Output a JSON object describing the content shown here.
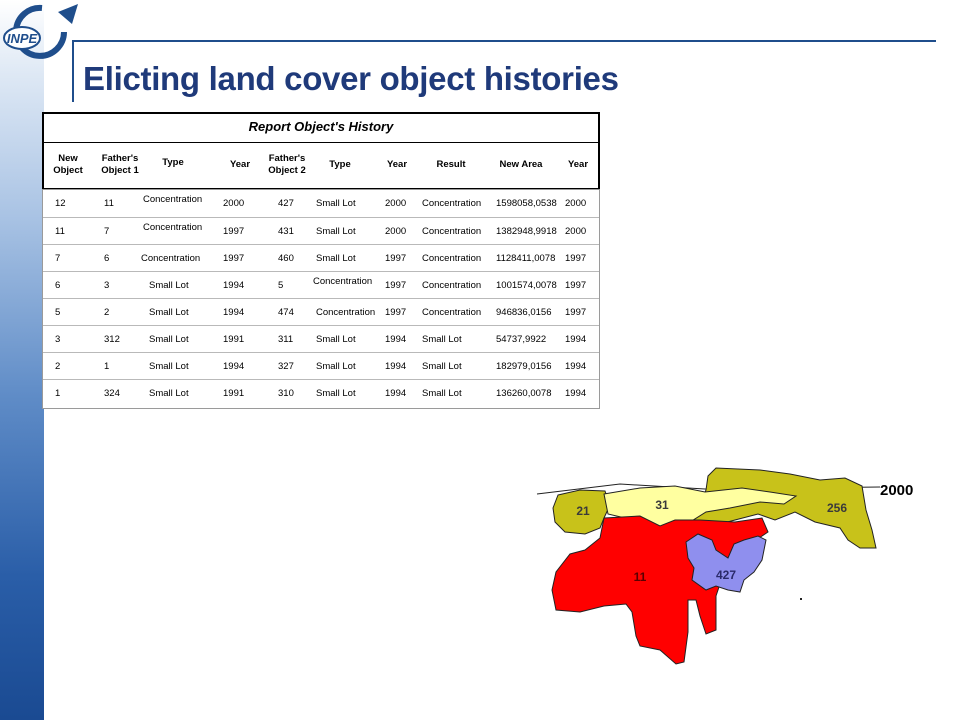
{
  "slide": {
    "title": "Elicting land cover object histories",
    "logo_text": "INPE"
  },
  "report": {
    "title": "Report Object's History",
    "columns": [
      "New Object",
      "Father's Object 1",
      "Type",
      "Year",
      "Father's Object 2",
      "Type",
      "Year",
      "Result",
      "New Area",
      "Year"
    ],
    "rows": [
      [
        "12",
        "11",
        "Concentration",
        "2000",
        "427",
        "Small Lot",
        "2000",
        "Concentration",
        "1598058,0538",
        "2000"
      ],
      [
        "11",
        "7",
        "Concentration",
        "1997",
        "431",
        "Small Lot",
        "2000",
        "Concentration",
        "1382948,9918",
        "2000"
      ],
      [
        "7",
        "6",
        "Concentration",
        "1997",
        "460",
        "Small Lot",
        "1997",
        "Concentration",
        "1128411,0078",
        "1997"
      ],
      [
        "6",
        "3",
        "Small Lot",
        "1994",
        "5",
        "Concentration",
        "1997",
        "Concentration",
        "1001574,0078",
        "1997"
      ],
      [
        "5",
        "2",
        "Small Lot",
        "1994",
        "474",
        "Concentration",
        "1997",
        "Concentration",
        "946836,0156",
        "1997"
      ],
      [
        "3",
        "312",
        "Small Lot",
        "1991",
        "311",
        "Small Lot",
        "1994",
        "Small Lot",
        "54737,9922",
        "1994"
      ],
      [
        "2",
        "1",
        "Small Lot",
        "1994",
        "327",
        "Small Lot",
        "1994",
        "Small Lot",
        "182979,0156",
        "1994"
      ],
      [
        "1",
        "324",
        "Small Lot",
        "1991",
        "310",
        "Small Lot",
        "1994",
        "Small Lot",
        "136260,0078",
        "1994"
      ]
    ]
  },
  "map": {
    "year_label": "2000",
    "region_labels": [
      "21",
      "31",
      "256",
      "11",
      "427"
    ],
    "colors": {
      "olive": "#c8c21a",
      "pale_yellow": "#ffffa0",
      "red": "#ff0000",
      "lavender": "#8f8fee",
      "outline": "#222222"
    }
  }
}
